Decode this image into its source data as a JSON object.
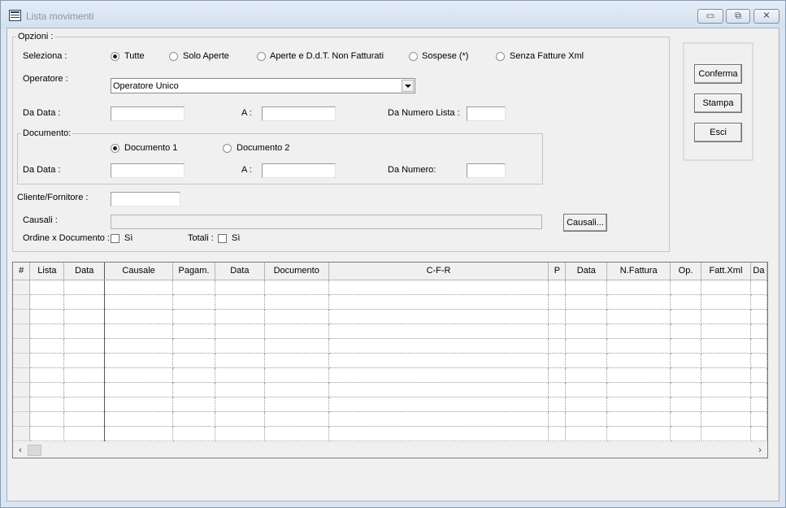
{
  "window": {
    "title": "Lista movimenti",
    "buttons": {
      "minimize": "▭",
      "restore": "⧉",
      "close": "✕"
    }
  },
  "options": {
    "legend": "Opzioni :",
    "seleziona_label": "Seleziona :",
    "radios": [
      "Tutte",
      "Solo Aperte",
      "Aperte e D.d.T. Non Fatturati",
      "Sospese (*)",
      "Senza Fatture Xml"
    ],
    "selected_radio": "Tutte",
    "operatore_label": "Operatore :",
    "operatore_value": "Operatore Unico",
    "da_data_label": "Da Data :",
    "a_label": "A :",
    "da_numero_lista_label": "Da Numero Lista :",
    "documento": {
      "legend": "Documento:",
      "radios": [
        "Documento 1",
        "Documento 2"
      ],
      "selected_radio": "Documento 1",
      "da_data_label": "Da Data :",
      "a_label": "A :",
      "da_numero_label": "Da Numero:"
    },
    "cliente_label": "Cliente/Fornitore :",
    "causali_label": "Causali :",
    "causali_button": "Causali...",
    "ordine_label": "Ordine x Documento :",
    "ordine_check": "Sì",
    "totali_label": "Totali :",
    "totali_check": "Sì"
  },
  "actions": {
    "conferma": "Conferma",
    "stampa": "Stampa",
    "esci": "Esci"
  },
  "grid": {
    "columns": [
      "#",
      "Lista",
      "Data",
      "Causale",
      "Pagam.",
      "Data",
      "Documento",
      "C-F-R",
      "P",
      "Data",
      "N.Fattura",
      "Op.",
      "Fatt.Xml",
      "Da"
    ],
    "visible_rows": 11
  },
  "colors": {
    "window_bg": "#dbe5f1",
    "form_bg": "#f0f0f0",
    "grid_bg": "#ffffff"
  }
}
